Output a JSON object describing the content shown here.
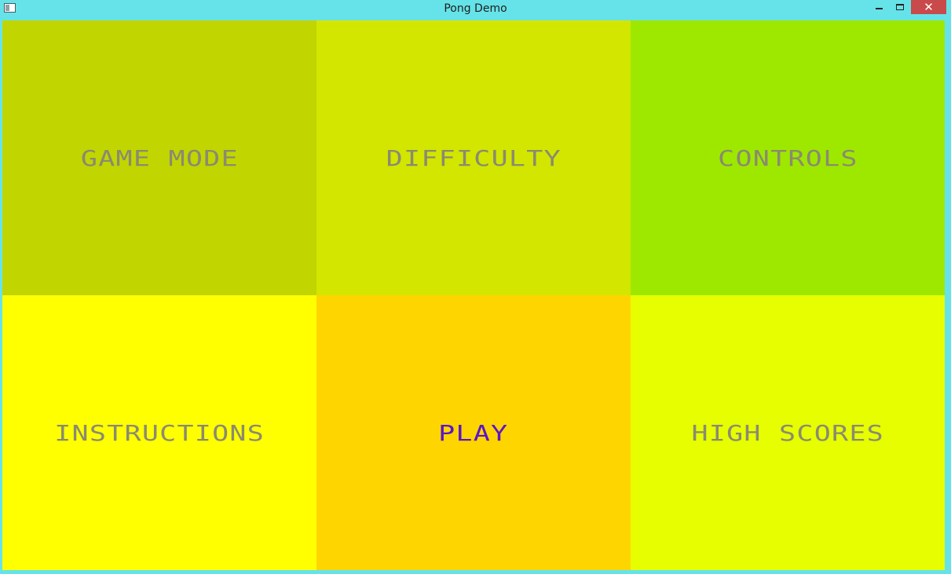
{
  "window": {
    "title": "Pong Demo",
    "close_glyph": "✕"
  },
  "menu": {
    "tiles": [
      {
        "label": "GAME MODE",
        "color": "#c1d500"
      },
      {
        "label": "DIFFICULTY",
        "color": "#d2e600"
      },
      {
        "label": "CONTROLS",
        "color": "#9ee800"
      },
      {
        "label": "INSTRUCTIONS",
        "color": "#ffff00"
      },
      {
        "label": "PLAY",
        "color": "#ffd500",
        "selected": true
      },
      {
        "label": "HIGH SCORES",
        "color": "#e6fe00"
      }
    ],
    "label_color": "#8a8a70",
    "selected_label_color": "#5a16c8"
  }
}
